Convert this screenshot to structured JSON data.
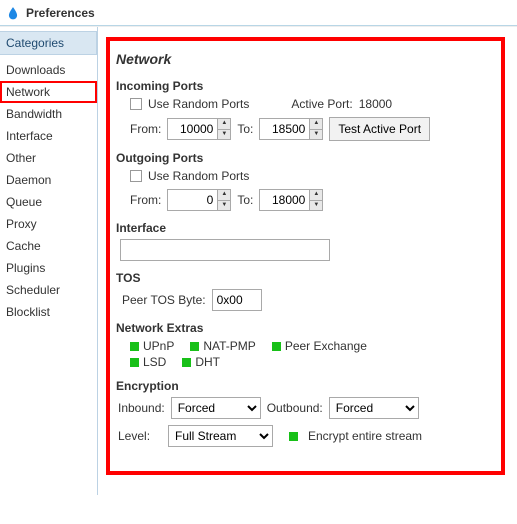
{
  "window": {
    "title": "Preferences"
  },
  "sidebar": {
    "header": "Categories",
    "items": [
      "Downloads",
      "Network",
      "Bandwidth",
      "Interface",
      "Other",
      "Daemon",
      "Queue",
      "Proxy",
      "Cache",
      "Plugins",
      "Scheduler",
      "Blocklist"
    ],
    "selected_index": 1
  },
  "panel": {
    "title": "Network",
    "incoming": {
      "title": "Incoming Ports",
      "random_label": "Use Random Ports",
      "random_checked": false,
      "active_port_label": "Active Port:",
      "active_port_value": "18000",
      "from_label": "From:",
      "from_value": "10000",
      "to_label": "To:",
      "to_value": "18500",
      "test_button": "Test Active Port"
    },
    "outgoing": {
      "title": "Outgoing Ports",
      "random_label": "Use Random Ports",
      "random_checked": false,
      "from_label": "From:",
      "from_value": "0",
      "to_label": "To:",
      "to_value": "18000"
    },
    "interface": {
      "title": "Interface",
      "value": ""
    },
    "tos": {
      "title": "TOS",
      "label": "Peer TOS Byte:",
      "value": "0x00"
    },
    "extras": {
      "title": "Network Extras",
      "items": [
        "UPnP",
        "NAT-PMP",
        "Peer Exchange",
        "LSD",
        "DHT"
      ]
    },
    "encryption": {
      "title": "Encryption",
      "inbound_label": "Inbound:",
      "inbound_value": "Forced",
      "outbound_label": "Outbound:",
      "outbound_value": "Forced",
      "level_label": "Level:",
      "level_value": "Full Stream",
      "entire_label": "Encrypt entire stream",
      "entire_checked": true
    }
  }
}
